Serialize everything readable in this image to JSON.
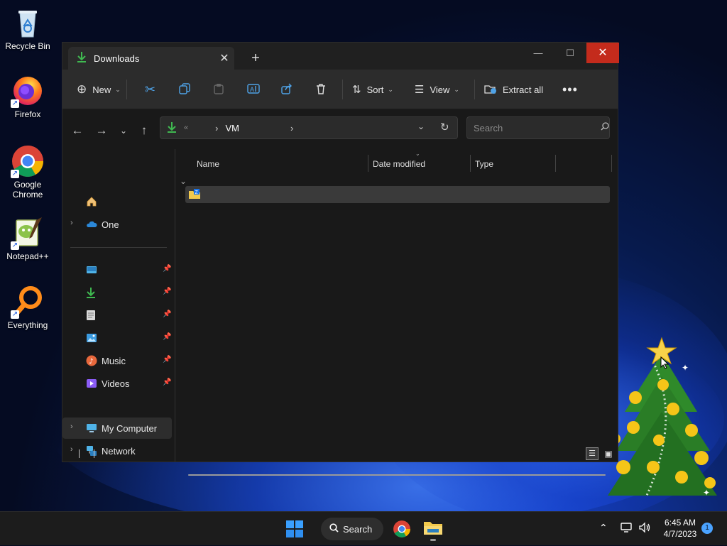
{
  "desktop": {
    "icons": [
      {
        "label": "Recycle Bin"
      },
      {
        "label": "Firefox"
      },
      {
        "label": "Google Chrome"
      },
      {
        "label": "Notepad++"
      },
      {
        "label": "Everything"
      }
    ]
  },
  "window": {
    "tab_title": "Downloads",
    "toolbar": {
      "new_label": "New",
      "sort_label": "Sort",
      "view_label": "View",
      "extract_label": "Extract all"
    },
    "address": {
      "overflow": "«",
      "crumb_sep1": "›",
      "crumb_folder": "VM",
      "crumb_sep2": "›"
    },
    "search": {
      "placeholder": "Search"
    },
    "nav": {
      "onedrive": "One",
      "music": "Music",
      "videos": "Videos",
      "computer": "My Computer",
      "network": "Network"
    },
    "columns": {
      "name": "Name",
      "date": "Date modified",
      "type": "Type"
    }
  },
  "taskbar": {
    "search_label": "Search",
    "time": "6:45 AM",
    "date": "4/7/2023",
    "notification_count": "1"
  },
  "colors": {
    "accent_green": "#3fb950",
    "close_red": "#c42b1c",
    "windows_blue": "#0078d4"
  }
}
